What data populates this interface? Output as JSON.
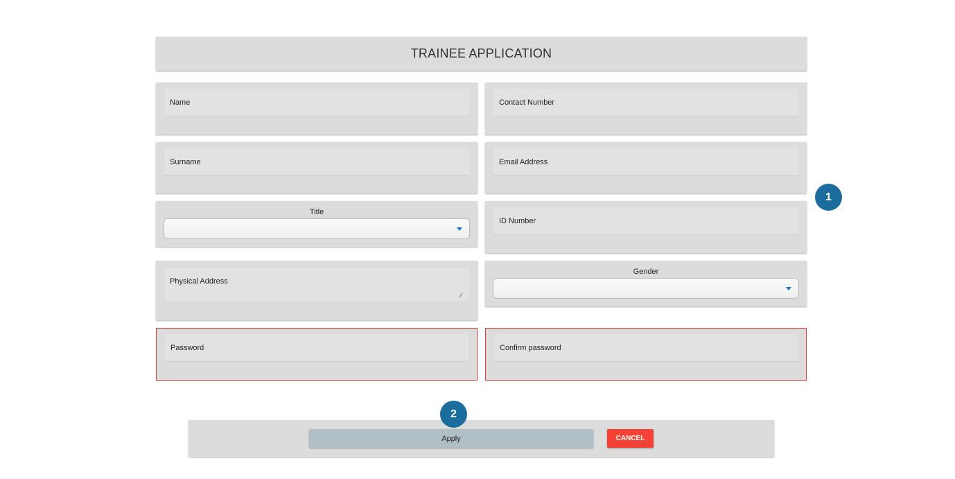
{
  "form": {
    "title": "TRAINEE APPLICATION",
    "fields": {
      "name": "Name",
      "contact_number": "Contact Number",
      "surname": "Surname",
      "email_address": "Email Address",
      "title_label": "Title",
      "title_value": "",
      "id_number": "ID Number",
      "physical_address": "Physical Address",
      "gender_label": "Gender",
      "gender_value": "",
      "password": "Password",
      "confirm_password": "Confirm password"
    },
    "error_border_color": "#e53935"
  },
  "actions": {
    "apply_label": "Apply",
    "cancel_label": "CANCEL"
  },
  "badges": {
    "step_1": "1",
    "step_2": "2"
  },
  "colors": {
    "badge": "#1a6d9c",
    "apply": "#b0bec5",
    "cancel": "#f44336",
    "dropdown_arrow": "#1a73c8"
  }
}
